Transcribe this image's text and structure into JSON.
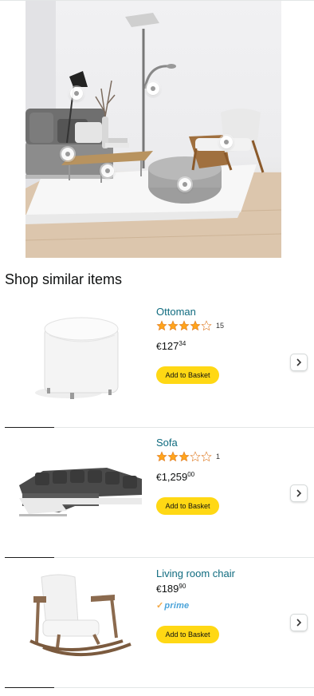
{
  "section_title": "Shop similar items",
  "products": [
    {
      "name": "Ottoman",
      "rating": 4,
      "max_rating": 5,
      "rating_count": "15",
      "price_currency": "€",
      "price_whole": "127",
      "price_fraction": "34",
      "button_label": "Add to Basket",
      "image_icon": "white-round-ottoman-image"
    },
    {
      "name": "Sofa",
      "rating": 3,
      "max_rating": 5,
      "rating_count": "1",
      "price_currency": "€",
      "price_whole": "1,259",
      "price_fraction": "00",
      "button_label": "Add to Basket",
      "image_icon": "grey-corner-sofa-image"
    },
    {
      "name": "Living room chair",
      "price_currency": "€",
      "price_whole": "189",
      "price_fraction": "90",
      "prime_label": "prime",
      "button_label": "Add to Basket",
      "image_icon": "white-rocking-chair-image"
    }
  ],
  "colors": {
    "link": "#0f6b7f",
    "button": "#ffd814",
    "star": "#ffa41c",
    "prime": "#4aa3d9"
  }
}
